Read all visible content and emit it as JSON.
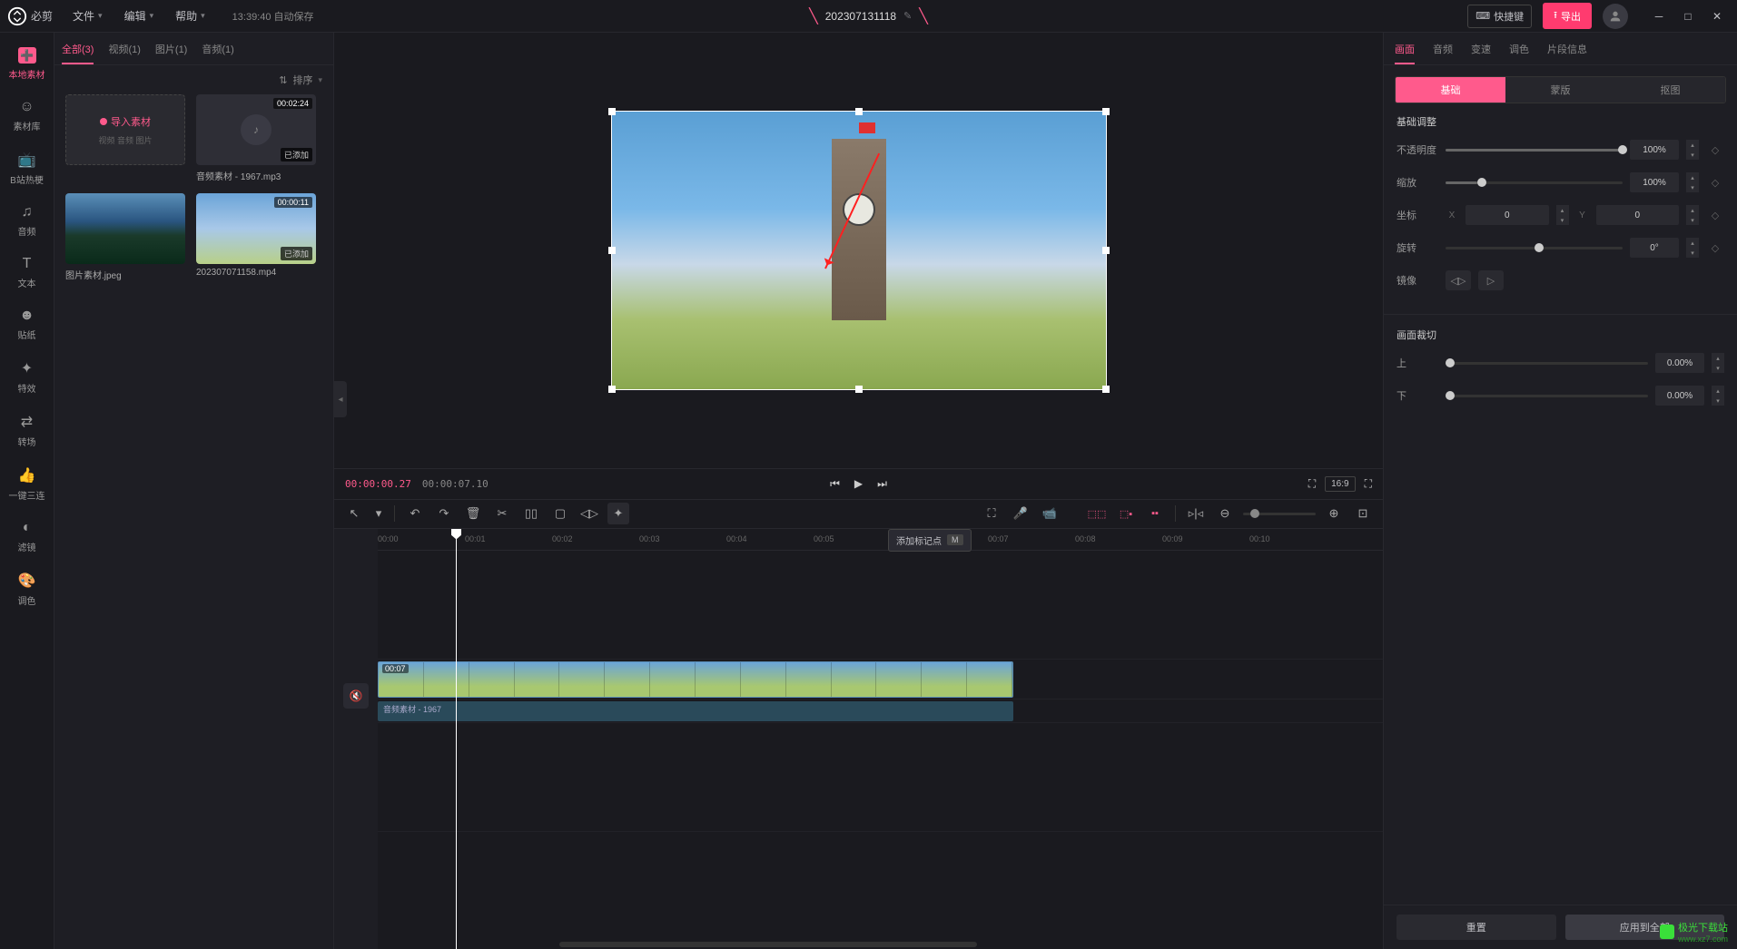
{
  "app": {
    "name": "必剪"
  },
  "menu": {
    "file": "文件",
    "edit": "编辑",
    "help": "帮助",
    "autosave": "13:39:40 自动保存"
  },
  "project": {
    "name": "202307131118"
  },
  "header": {
    "shortcut_icon": "⌨",
    "shortcut_label": "快捷键",
    "export_label": "导出"
  },
  "sidebar": {
    "items": [
      {
        "icon": "➕",
        "label": "本地素材",
        "active": true
      },
      {
        "icon": "☺",
        "label": "素材库"
      },
      {
        "icon": "📺",
        "label": "B站热梗"
      },
      {
        "icon": "♫",
        "label": "音频"
      },
      {
        "icon": "T",
        "label": "文本"
      },
      {
        "icon": "☻",
        "label": "贴纸"
      },
      {
        "icon": "✦",
        "label": "特效"
      },
      {
        "icon": "⇄",
        "label": "转场"
      },
      {
        "icon": "👍",
        "label": "一键三连"
      },
      {
        "icon": "◐",
        "label": "滤镜"
      },
      {
        "icon": "🎨",
        "label": "调色"
      }
    ]
  },
  "media": {
    "tabs": [
      {
        "label": "全部(3)",
        "active": true
      },
      {
        "label": "视频(1)"
      },
      {
        "label": "图片(1)"
      },
      {
        "label": "音频(1)"
      }
    ],
    "sort_label": "排序",
    "import": {
      "label": "导入素材",
      "sub": "视频 音频 图片"
    },
    "items": [
      {
        "type": "audio",
        "duration": "00:02:24",
        "added": "已添加",
        "name": "音频素材 - 1967.mp3"
      },
      {
        "type": "image",
        "thumb": "img1",
        "name": "图片素材.jpeg"
      },
      {
        "type": "video",
        "thumb": "img2",
        "duration": "00:00:11",
        "added": "已添加",
        "name": "202307071158.mp4"
      }
    ]
  },
  "preview": {
    "current_time": "00:00:00.27",
    "total_time": "00:00:07.10",
    "ratio": "16:9"
  },
  "timeline_toolbar": {
    "tooltip_text": "添加标记点",
    "tooltip_key": "M"
  },
  "ruler": [
    "00:00",
    "00:01",
    "00:02",
    "00:03",
    "00:04",
    "00:05",
    "00:06",
    "00:07",
    "00:08",
    "00:09",
    "00:10"
  ],
  "tracks": {
    "video_clip_time": "00:07",
    "audio_clip_label": "音频素材 - 1967"
  },
  "props": {
    "tabs": [
      {
        "label": "画面",
        "active": true
      },
      {
        "label": "音频"
      },
      {
        "label": "变速"
      },
      {
        "label": "调色"
      },
      {
        "label": "片段信息"
      }
    ],
    "subtabs": [
      {
        "label": "基础",
        "active": true
      },
      {
        "label": "蒙版"
      },
      {
        "label": "抠图"
      }
    ],
    "section1_title": "基础调整",
    "opacity": {
      "label": "不透明度",
      "value": "100%"
    },
    "scale": {
      "label": "缩放",
      "value": "100%"
    },
    "position": {
      "label": "坐标",
      "x_label": "X",
      "x": "0",
      "y_label": "Y",
      "y": "0"
    },
    "rotation": {
      "label": "旋转",
      "value": "0°"
    },
    "mirror": {
      "label": "镜像"
    },
    "section2_title": "画面裁切",
    "crop_top": {
      "label": "上",
      "value": "0.00%"
    },
    "crop_bottom": {
      "label": "下",
      "value": "0.00%"
    },
    "reset": "重置",
    "apply_all": "应用到全部"
  },
  "watermark": {
    "text": "极光下载站",
    "url": "www.xz7.com"
  }
}
